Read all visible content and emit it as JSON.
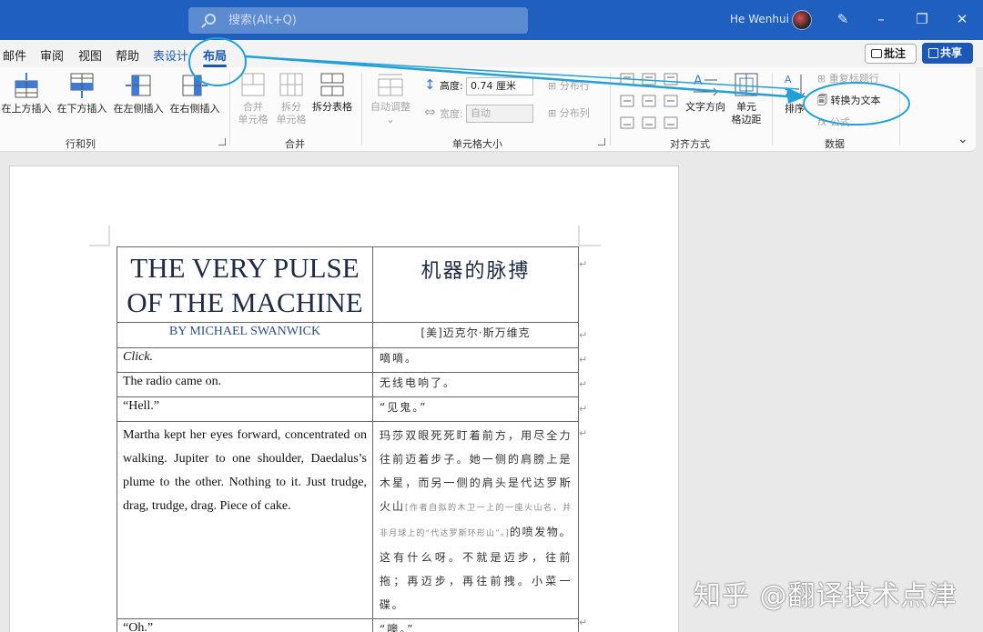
{
  "titlebar": {
    "search_placeholder": "搜索(Alt+Q)",
    "user_name": "He Wenhui",
    "icons": [
      "search-icon",
      "avatar",
      "pen-icon",
      "minimize-icon",
      "restore-icon",
      "close-icon"
    ]
  },
  "menu": {
    "tabs": [
      "邮件",
      "审阅",
      "视图",
      "帮助",
      "表设计",
      "布局"
    ],
    "active": "布局",
    "comment_label": "批注",
    "share_label": "共享"
  },
  "ribbon": {
    "rows_cols": {
      "label": "行和列",
      "insert_above": "在上方插入",
      "insert_below": "在下方插入",
      "insert_left": "在左侧插入",
      "insert_right": "在右侧插入"
    },
    "merge": {
      "label": "合并",
      "merge_cells_1": "合并",
      "merge_cells_2": "单元格",
      "split_cells_1": "拆分",
      "split_cells_2": "单元格",
      "split_table": "拆分表格"
    },
    "cell_size": {
      "label": "单元格大小",
      "autofit": "自动调整",
      "height_label": "高度:",
      "height_value": "0.74 厘米",
      "width_label": "宽度:",
      "width_value": "自动",
      "distribute_rows": "分布行",
      "distribute_cols": "分布列"
    },
    "alignment": {
      "label": "对齐方式",
      "text_direction": "文字方向",
      "cell_margins_1": "单元",
      "cell_margins_2": "格边距"
    },
    "data": {
      "label": "数据",
      "sort": "排序",
      "repeat_header": "重复标题行",
      "convert_to_text": "转换为文本",
      "formula": "公式"
    }
  },
  "document": {
    "rows": [
      {
        "en": "THE VERY PULSE OF THE MACHINE",
        "zh": "机器的脉搏"
      },
      {
        "en": "BY MICHAEL SWANWICK",
        "zh": "[美]迈克尔·斯万维克"
      },
      {
        "en": "Click.",
        "zh": "嘀嘀。"
      },
      {
        "en": "The radio came on.",
        "zh": "无线电响了。"
      },
      {
        "en": "“Hell.”",
        "zh": "“见鬼。”"
      },
      {
        "en": "Martha kept her eyes forward, concentrated on walking. Jupiter to one shoulder, Daedalus’s plume to the other. Nothing to it. Just trudge, drag, trudge, drag. Piece of cake.",
        "zh_a": "玛莎双眼死死盯着前方，用尽全力往前迈着步子。她一侧的肩膀上是木星，而另一侧的肩头是代达罗斯火山",
        "zh_note": "[作者自拟的木卫一上的一座火山名，并非月球上的“代达罗斯环形山”。]",
        "zh_b": "的喷发物。这有什么呀。不就是迈步，往前拖；再迈步，再往前拽。小菜一碟。"
      },
      {
        "en": "“Oh.”",
        "zh": "“噢。”"
      }
    ]
  },
  "watermark": "知乎 @翻译技术点津",
  "annotation_color": "#22a0d8"
}
